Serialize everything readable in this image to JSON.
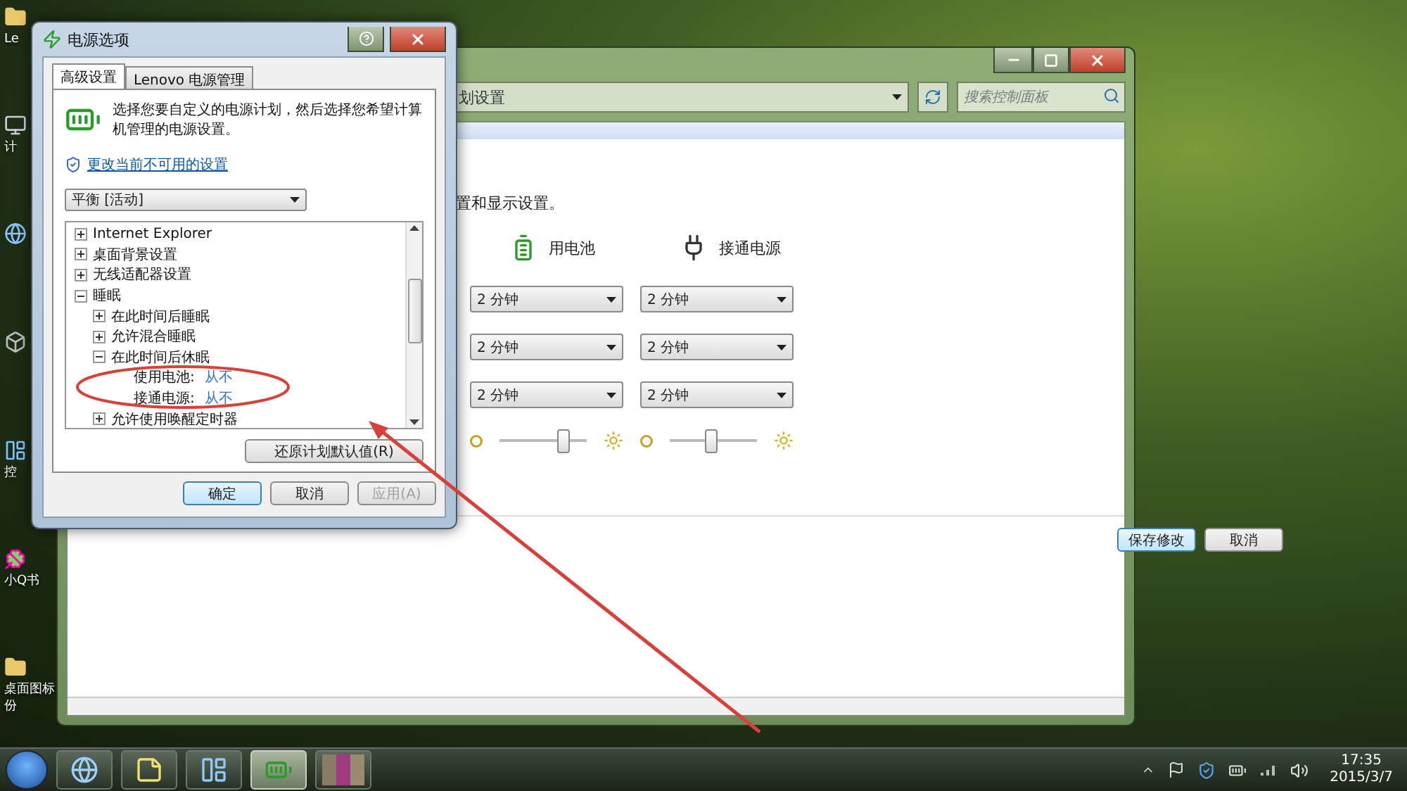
{
  "desktop": {
    "icons": [
      {
        "kind": "folder",
        "label": "Le"
      },
      {
        "kind": "computer",
        "label": "计"
      },
      {
        "kind": "globe"
      },
      {
        "kind": "generic"
      },
      {
        "kind": "control",
        "label": "控"
      },
      {
        "kind": "clover",
        "label": "小Q书"
      },
      {
        "kind": "folder",
        "label": "桌面图标份"
      }
    ]
  },
  "control_panel_window": {
    "address": "划设置",
    "search": {
      "placeholder": "搜索控制面板"
    },
    "intro": "置和显示设置。",
    "columns": [
      {
        "kind": "battery",
        "label": "用电池"
      },
      {
        "kind": "plug",
        "label": "接通电源"
      }
    ],
    "rows": [
      [
        "2 分钟",
        "2 分钟"
      ],
      [
        "2 分钟",
        "2 分钟"
      ],
      [
        "2 分钟",
        "2 分钟"
      ]
    ],
    "brightness": [
      {
        "level": 0.72
      },
      {
        "level": 0.47
      }
    ],
    "buttons": [
      {
        "label": "保存修改",
        "default": true
      },
      {
        "label": "取消",
        "default": false
      }
    ]
  },
  "dialog": {
    "title": "电源选项",
    "tabs": [
      {
        "label": "高级设置",
        "selected": true
      },
      {
        "label": "Lenovo 电源管理",
        "selected": false
      }
    ],
    "description": "选择您要自定义的电源计划，然后选择您希望计算机管理的电源设置。",
    "link": "更改当前不可用的设置",
    "plan": "平衡 [活动]",
    "tree": [
      {
        "kind": "group",
        "label": "Internet Explorer",
        "expanded": false
      },
      {
        "kind": "group",
        "label": "桌面背景设置",
        "expanded": false
      },
      {
        "kind": "group",
        "label": "无线适配器设置",
        "expanded": false
      },
      {
        "kind": "group",
        "label": "睡眠",
        "expanded": true,
        "children": [
          {
            "kind": "group",
            "label": "在此时间后睡眠",
            "expanded": false
          },
          {
            "kind": "group",
            "label": "允许混合睡眠",
            "expanded": false
          },
          {
            "kind": "group",
            "label": "在此时间后休眠",
            "expanded": true,
            "children": [
              {
                "kind": "setting",
                "label": "使用电池:",
                "value": "从不"
              },
              {
                "kind": "setting",
                "label": "接通电源:",
                "value": "从不"
              }
            ]
          },
          {
            "kind": "group",
            "label": "允许使用唤醒定时器",
            "expanded": false
          }
        ]
      }
    ],
    "restore_button": "还原计划默认值(R)",
    "buttons": [
      {
        "label": "确定",
        "default": true,
        "disabled": false
      },
      {
        "label": "取消",
        "default": false,
        "disabled": false
      },
      {
        "label": "应用(A)",
        "default": false,
        "disabled": true
      }
    ]
  },
  "taskbar": {
    "items": [
      {
        "kind": "globe",
        "selected": false
      },
      {
        "kind": "notes",
        "selected": false
      },
      {
        "kind": "control",
        "selected": false
      },
      {
        "kind": "power",
        "selected": true
      },
      {
        "kind": "blurred",
        "selected": false
      }
    ],
    "time": "17:35",
    "date": "2015/3/7"
  }
}
